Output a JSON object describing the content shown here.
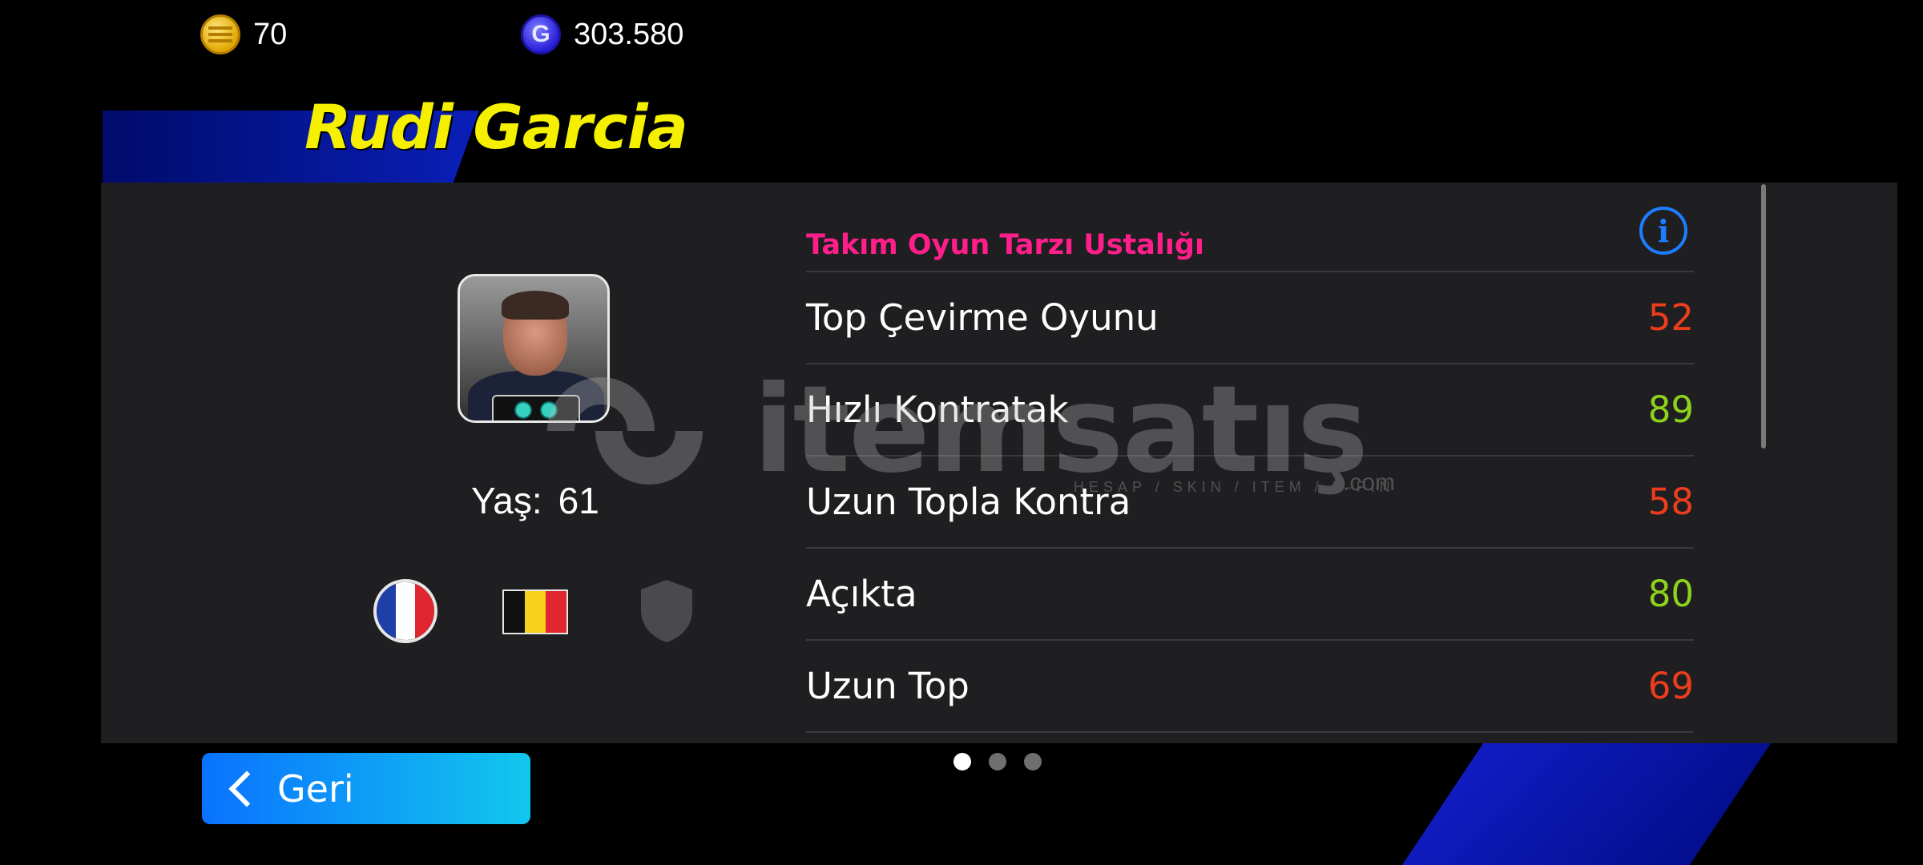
{
  "currency": {
    "coins": "70",
    "gp": "303.580",
    "gp_symbol": "G"
  },
  "manager": {
    "name": "Rudi Garcia",
    "age_label": "Yaş:",
    "age": "61"
  },
  "flags": [
    "france-flag",
    "belgium-flag"
  ],
  "section": {
    "title": "Takım Oyun Tarzı Ustalığı",
    "info_symbol": "i"
  },
  "stats": [
    {
      "label": "Top Çevirme Oyunu",
      "value": "52",
      "color": "#ee3d1c"
    },
    {
      "label": "Hızlı Kontratak",
      "value": "89",
      "color": "#8ed21c"
    },
    {
      "label": "Uzun Topla Kontra",
      "value": "58",
      "color": "#ee3d1c"
    },
    {
      "label": "Açıkta",
      "value": "80",
      "color": "#8ed21c"
    },
    {
      "label": "Uzun Top",
      "value": "69",
      "color": "#ee3d1c"
    }
  ],
  "pagination": {
    "pages": 3,
    "active": 1
  },
  "back_button": {
    "label": "Geri"
  },
  "watermark": {
    "brand": "itemsatış",
    "tagline": "HESAP / SKIN / ITEM / E-PIN",
    "tld": ".com"
  },
  "colors": {
    "title": "#f5f000",
    "section_title": "#ff1e8a",
    "accent_blue": "#1e7cff",
    "panel": "#1f1f21"
  }
}
